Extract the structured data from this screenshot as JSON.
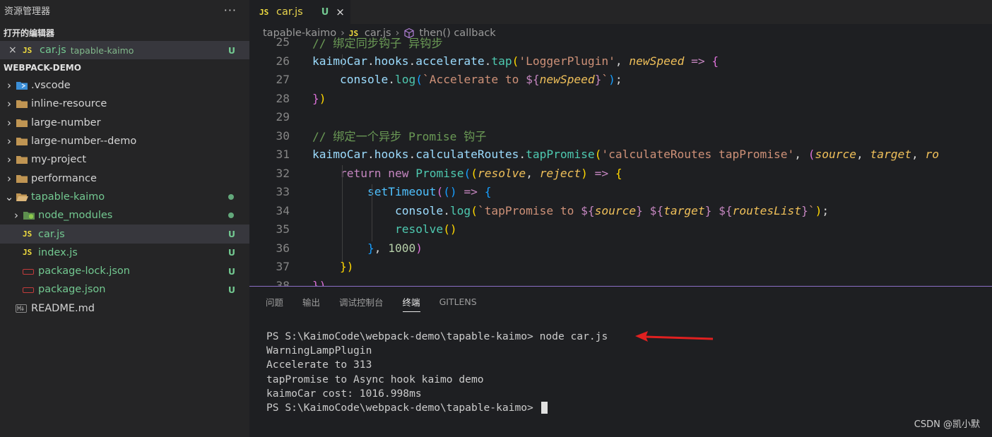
{
  "sidebar": {
    "title": "资源管理器",
    "more": "···",
    "open_editors_label": "打开的编辑器",
    "open_editor": {
      "close": "×",
      "type": "JS",
      "name": "car.js",
      "folder": "tapable-kaimo",
      "badge": "U"
    },
    "workspace_label": "WEBPACK-DEMO",
    "tree": [
      {
        "name": ".vscode",
        "kind": "vscode-folder",
        "level": 0,
        "chevron": "›"
      },
      {
        "name": "inline-resource",
        "kind": "folder",
        "level": 0,
        "chevron": "›"
      },
      {
        "name": "large-number",
        "kind": "folder",
        "level": 0,
        "chevron": "›"
      },
      {
        "name": "large-number--demo",
        "kind": "folder",
        "level": 0,
        "chevron": "›"
      },
      {
        "name": "my-project",
        "kind": "folder",
        "level": 0,
        "chevron": "›"
      },
      {
        "name": "performance",
        "kind": "folder",
        "level": 0,
        "chevron": "›"
      },
      {
        "name": "tapable-kaimo",
        "kind": "folder-open",
        "level": 0,
        "chevron": "⌄",
        "dot": true
      },
      {
        "name": "node_modules",
        "kind": "node-folder",
        "level": 1,
        "chevron": "›",
        "dot": true
      },
      {
        "name": "car.js",
        "kind": "js",
        "type": "JS",
        "level": 1,
        "badge": "U",
        "selected": true
      },
      {
        "name": "index.js",
        "kind": "js",
        "type": "JS",
        "level": 1,
        "badge": "U"
      },
      {
        "name": "package-lock.json",
        "kind": "json",
        "level": 1,
        "badge": "U"
      },
      {
        "name": "package.json",
        "kind": "json",
        "level": 1,
        "badge": "U"
      },
      {
        "name": "README.md",
        "kind": "markdown",
        "level": 0
      }
    ]
  },
  "editor": {
    "tab": {
      "type": "JS",
      "label": "car.js",
      "status": "U",
      "close": "×"
    },
    "breadcrumb": {
      "folder": "tapable-kaimo",
      "sep1": "›",
      "type": "JS",
      "file": "car.js",
      "sep2": "›",
      "symbol": "then() callback"
    },
    "lines": [
      {
        "n": "25",
        "tokens": [
          [
            "t-cm",
            "// 绑定同步钩子 异钩步"
          ]
        ]
      },
      {
        "n": "26",
        "tokens": [
          [
            "t-var",
            "kaimoCar"
          ],
          [
            "t-plain",
            "."
          ],
          [
            "t-var",
            "hooks"
          ],
          [
            "t-plain",
            "."
          ],
          [
            "t-var",
            "accelerate"
          ],
          [
            "t-plain",
            "."
          ],
          [
            "t-fn",
            "tap"
          ],
          [
            "t-br1",
            "("
          ],
          [
            "t-str",
            "'LoggerPlugin'"
          ],
          [
            "t-plain",
            ", "
          ],
          [
            "t-param",
            "newSpeed"
          ],
          [
            "t-plain",
            " "
          ],
          [
            "t-op",
            "=>"
          ],
          [
            "t-plain",
            " "
          ],
          [
            "t-br2",
            "{"
          ]
        ]
      },
      {
        "n": "27",
        "tokens": [
          [
            "t-plain",
            "    "
          ],
          [
            "t-var",
            "console"
          ],
          [
            "t-plain",
            "."
          ],
          [
            "t-fn",
            "log"
          ],
          [
            "t-br3",
            "("
          ],
          [
            "t-tmpl",
            "`Accelerate to "
          ],
          [
            "t-kw",
            "${"
          ],
          [
            "t-param",
            "newSpeed"
          ],
          [
            "t-kw",
            "}"
          ],
          [
            "t-tmpl",
            "`"
          ],
          [
            "t-br3",
            ")"
          ],
          [
            "t-plain",
            ";"
          ]
        ]
      },
      {
        "n": "28",
        "tokens": [
          [
            "t-br2",
            "}"
          ],
          [
            "t-br1",
            ")"
          ]
        ]
      },
      {
        "n": "29",
        "tokens": []
      },
      {
        "n": "30",
        "tokens": [
          [
            "t-cm",
            "// 绑定一个异步 Promise 钩子"
          ]
        ]
      },
      {
        "n": "31",
        "tokens": [
          [
            "t-var",
            "kaimoCar"
          ],
          [
            "t-plain",
            "."
          ],
          [
            "t-var",
            "hooks"
          ],
          [
            "t-plain",
            "."
          ],
          [
            "t-var",
            "calculateRoutes"
          ],
          [
            "t-plain",
            "."
          ],
          [
            "t-fn",
            "tapPromise"
          ],
          [
            "t-br1",
            "("
          ],
          [
            "t-str",
            "'calculateRoutes tapPromise'"
          ],
          [
            "t-plain",
            ", "
          ],
          [
            "t-br2",
            "("
          ],
          [
            "t-param",
            "source"
          ],
          [
            "t-plain",
            ", "
          ],
          [
            "t-param",
            "target"
          ],
          [
            "t-plain",
            ", "
          ],
          [
            "t-param",
            "ro"
          ]
        ]
      },
      {
        "n": "32",
        "tokens": [
          [
            "t-plain",
            "    "
          ],
          [
            "t-kw",
            "return"
          ],
          [
            "t-plain",
            " "
          ],
          [
            "t-kw",
            "new"
          ],
          [
            "t-plain",
            " "
          ],
          [
            "t-fn",
            "Promise"
          ],
          [
            "t-br3",
            "("
          ],
          [
            "t-br1",
            "("
          ],
          [
            "t-param",
            "resolve"
          ],
          [
            "t-plain",
            ", "
          ],
          [
            "t-param",
            "reject"
          ],
          [
            "t-br1",
            ")"
          ],
          [
            "t-plain",
            " "
          ],
          [
            "t-op",
            "=>"
          ],
          [
            "t-plain",
            " "
          ],
          [
            "t-br1",
            "{"
          ]
        ]
      },
      {
        "n": "33",
        "tokens": [
          [
            "t-plain",
            "        "
          ],
          [
            "t-fnc",
            "setTimeout"
          ],
          [
            "t-br2",
            "("
          ],
          [
            "t-br3",
            "()"
          ],
          [
            "t-plain",
            " "
          ],
          [
            "t-op",
            "=>"
          ],
          [
            "t-plain",
            " "
          ],
          [
            "t-br3",
            "{"
          ]
        ]
      },
      {
        "n": "34",
        "tokens": [
          [
            "t-plain",
            "            "
          ],
          [
            "t-var",
            "console"
          ],
          [
            "t-plain",
            "."
          ],
          [
            "t-fn",
            "log"
          ],
          [
            "t-br1",
            "("
          ],
          [
            "t-tmpl",
            "`tapPromise to "
          ],
          [
            "t-kw",
            "${"
          ],
          [
            "t-param",
            "source"
          ],
          [
            "t-kw",
            "}"
          ],
          [
            "t-tmpl",
            " "
          ],
          [
            "t-kw",
            "${"
          ],
          [
            "t-param",
            "target"
          ],
          [
            "t-kw",
            "}"
          ],
          [
            "t-tmpl",
            " "
          ],
          [
            "t-kw",
            "${"
          ],
          [
            "t-param",
            "routesList"
          ],
          [
            "t-kw",
            "}"
          ],
          [
            "t-tmpl",
            "`"
          ],
          [
            "t-br1",
            ")"
          ],
          [
            "t-plain",
            ";"
          ]
        ]
      },
      {
        "n": "35",
        "tokens": [
          [
            "t-plain",
            "            "
          ],
          [
            "t-fn",
            "resolve"
          ],
          [
            "t-br1",
            "()"
          ]
        ]
      },
      {
        "n": "36",
        "tokens": [
          [
            "t-plain",
            "        "
          ],
          [
            "t-br3",
            "}"
          ],
          [
            "t-plain",
            ", "
          ],
          [
            "t-num",
            "1000"
          ],
          [
            "t-br2",
            ")"
          ]
        ]
      },
      {
        "n": "37",
        "tokens": [
          [
            "t-plain",
            "    "
          ],
          [
            "t-br1",
            "})"
          ]
        ]
      },
      {
        "n": "38",
        "tokens": [
          [
            "t-br2",
            "})"
          ]
        ]
      }
    ]
  },
  "panel": {
    "tabs": [
      {
        "label": "问题",
        "active": false
      },
      {
        "label": "输出",
        "active": false
      },
      {
        "label": "调试控制台",
        "active": false
      },
      {
        "label": "终端",
        "active": true
      },
      {
        "label": "GITLENS",
        "active": false
      }
    ],
    "terminal": [
      "PS S:\\KaimoCode\\webpack-demo\\tapable-kaimo> node car.js",
      "WarningLampPlugin",
      "Accelerate to 313",
      "tapPromise to Async hook kaimo demo",
      "kaimoCar cost: 1016.998ms",
      "PS S:\\KaimoCode\\webpack-demo\\tapable-kaimo> "
    ],
    "arrow_color": "#e02020"
  },
  "watermark": "CSDN @凯小默"
}
